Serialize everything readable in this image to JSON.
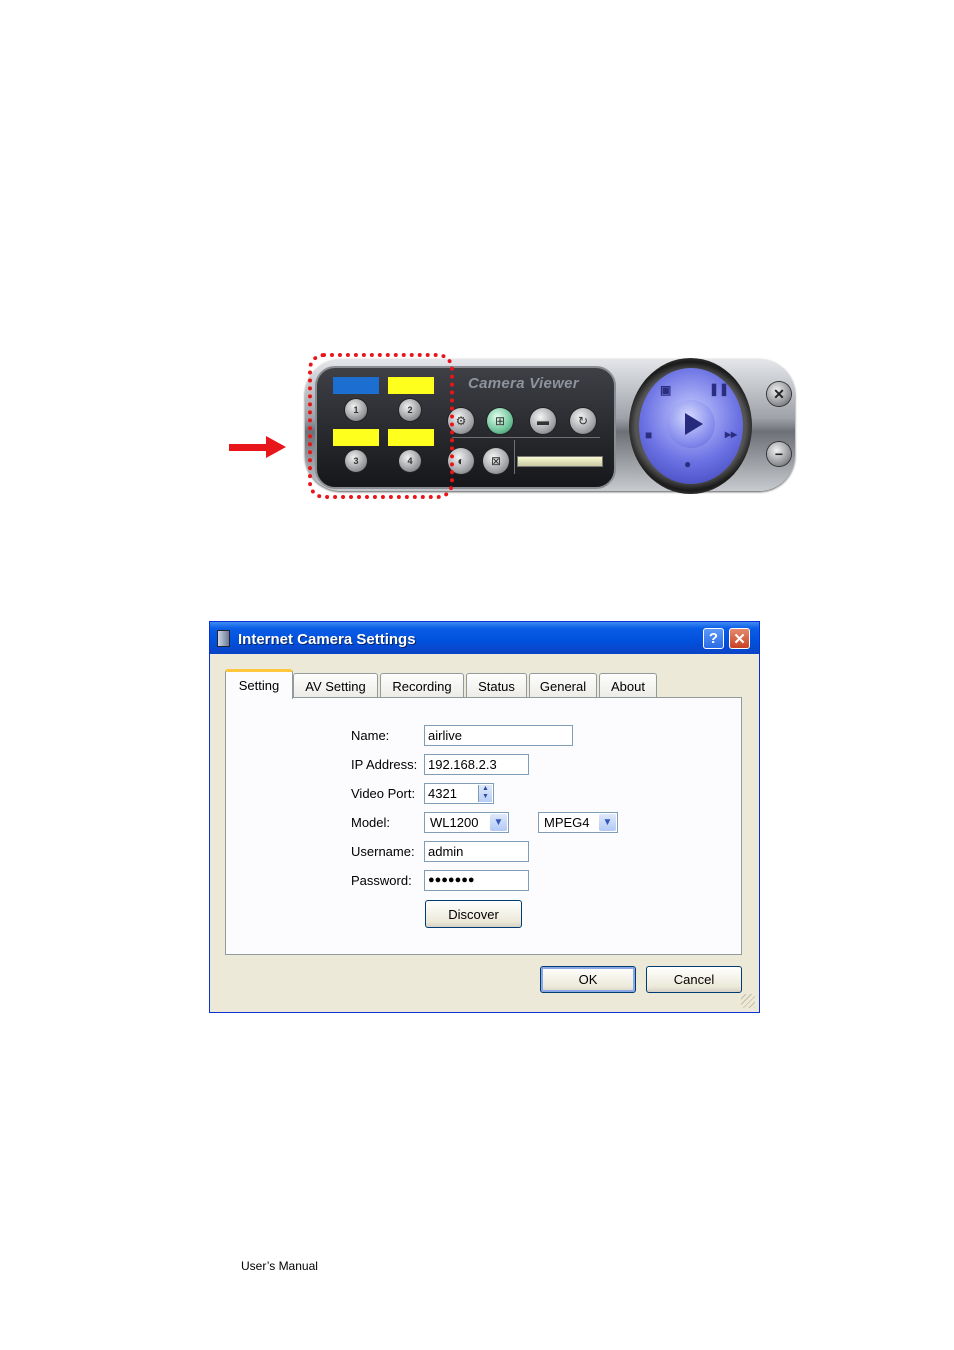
{
  "viewer": {
    "title": "Camera Viewer",
    "camera_buttons": [
      "1",
      "2",
      "3",
      "4"
    ],
    "camera_bar_colors": [
      "#1c6fd0",
      "#ffff1e",
      "#ffff1e",
      "#ffff1e"
    ]
  },
  "dialog": {
    "title": "Internet Camera Settings",
    "help_label": "?",
    "close_label": "✕",
    "tabs": [
      "Setting",
      "AV Setting",
      "Recording",
      "Status",
      "General",
      "About"
    ],
    "active_tab": "Setting",
    "form": {
      "name_label": "Name:",
      "name_value": "airlive",
      "ip_label": "IP Address:",
      "ip_value": "192.168.2.3",
      "port_label": "Video Port:",
      "port_value": "4321",
      "model_label": "Model:",
      "model_value": "WL1200",
      "codec_value": "MPEG4",
      "username_label": "Username:",
      "username_value": "admin",
      "password_label": "Password:",
      "password_value": "●●●●●●●",
      "discover_label": "Discover"
    },
    "ok_label": "OK",
    "cancel_label": "Cancel"
  },
  "footer": {
    "text": "User’s Manual"
  }
}
